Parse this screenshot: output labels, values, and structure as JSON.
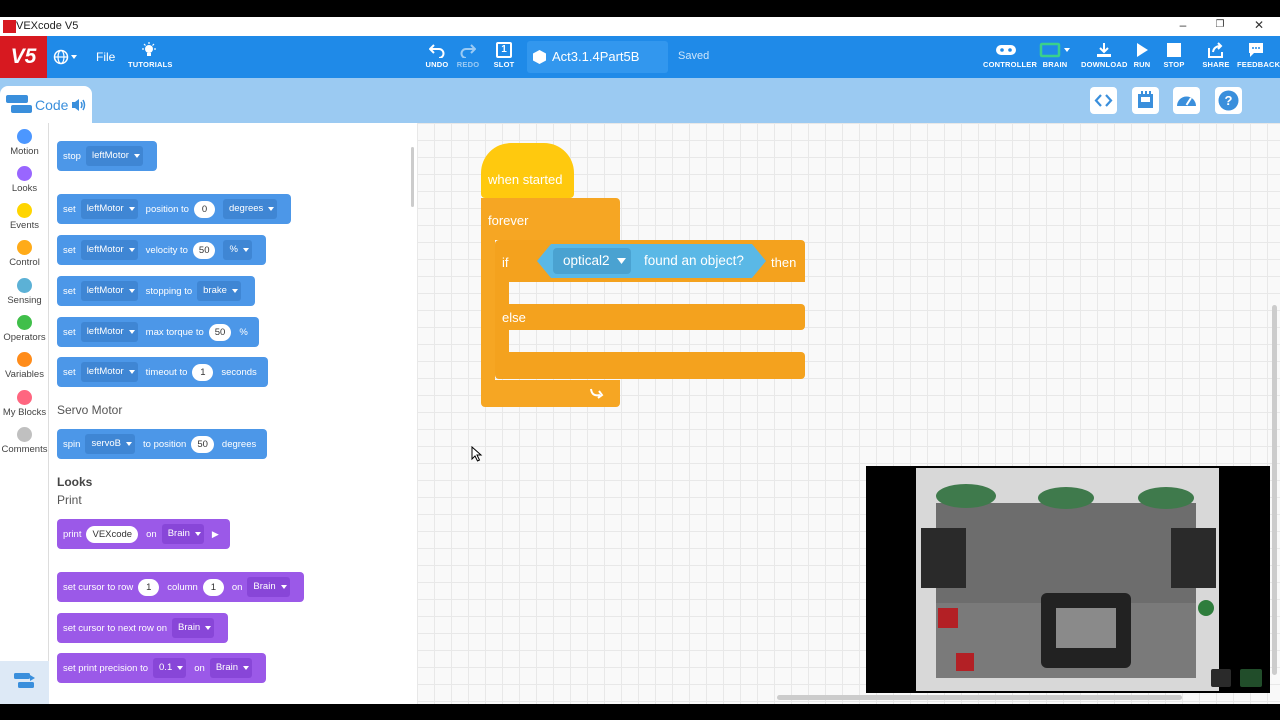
{
  "window": {
    "title": "VEXcode V5",
    "minimize": "–",
    "maximize": "❐",
    "close": "✕"
  },
  "menu": {
    "logo": "V5",
    "file": "File",
    "tutorials": "TUTORIALS",
    "undo": "UNDO",
    "redo": "REDO",
    "slot": "SLOT",
    "slot_number": "1",
    "project_name": "Act3.1.4Part5B",
    "save_status": "Saved",
    "controller": "CONTROLLER",
    "brain": "BRAIN",
    "download": "DOWNLOAD",
    "run": "RUN",
    "stop": "STOP",
    "share": "SHARE",
    "feedback": "FEEDBACK",
    "accent": "#1f8ae8",
    "logo_color": "#d71920"
  },
  "code_tab": {
    "label": "Code"
  },
  "categories": [
    {
      "label": "Motion",
      "color": "#4c97ff"
    },
    {
      "label": "Looks",
      "color": "#9966ff"
    },
    {
      "label": "Events",
      "color": "#ffd500"
    },
    {
      "label": "Control",
      "color": "#ffab19"
    },
    {
      "label": "Sensing",
      "color": "#5cb1d6"
    },
    {
      "label": "Operators",
      "color": "#40bf4a"
    },
    {
      "label": "Variables",
      "color": "#ff8c1a"
    },
    {
      "label": "My Blocks",
      "color": "#ff6680"
    },
    {
      "label": "Comments",
      "color": "#c0c0c0"
    }
  ],
  "palette": {
    "stop_block": {
      "t1": "stop",
      "dd1": "leftMotor"
    },
    "set_position": {
      "t1": "set",
      "dd1": "leftMotor",
      "t2": "position to",
      "val": "0",
      "dd2": "degrees"
    },
    "set_velocity": {
      "t1": "set",
      "dd1": "leftMotor",
      "t2": "velocity to",
      "val": "50",
      "dd2": "%"
    },
    "set_stopping": {
      "t1": "set",
      "dd1": "leftMotor",
      "t2": "stopping to",
      "dd2": "brake"
    },
    "set_torque": {
      "t1": "set",
      "dd1": "leftMotor",
      "t2": "max torque to",
      "val": "50",
      "t3": "%"
    },
    "set_timeout": {
      "t1": "set",
      "dd1": "leftMotor",
      "t2": "timeout to",
      "val": "1",
      "t3": "seconds"
    },
    "servo_heading": "Servo Motor",
    "spin_servo": {
      "t1": "spin",
      "dd1": "servoB",
      "t2": "to position",
      "val": "50",
      "t3": "degrees"
    },
    "looks_heading": "Looks",
    "print_heading": "Print",
    "print_block": {
      "t1": "print",
      "val": "VEXcode",
      "t2": "on",
      "dd1": "Brain"
    },
    "set_cursor": {
      "t1": "set cursor to row",
      "val1": "1",
      "t2": "column",
      "val2": "1",
      "t3": "on",
      "dd1": "Brain"
    },
    "next_row": {
      "t1": "set cursor to next row on",
      "dd1": "Brain"
    },
    "precision": {
      "t1": "set print precision to",
      "dd1": "0.1",
      "t2": "on",
      "dd2": "Brain"
    }
  },
  "script": {
    "hat": "when started",
    "forever": "forever",
    "if": "if",
    "sensor": "optical2",
    "condition": "found an object?",
    "then": "then",
    "else": "else"
  }
}
